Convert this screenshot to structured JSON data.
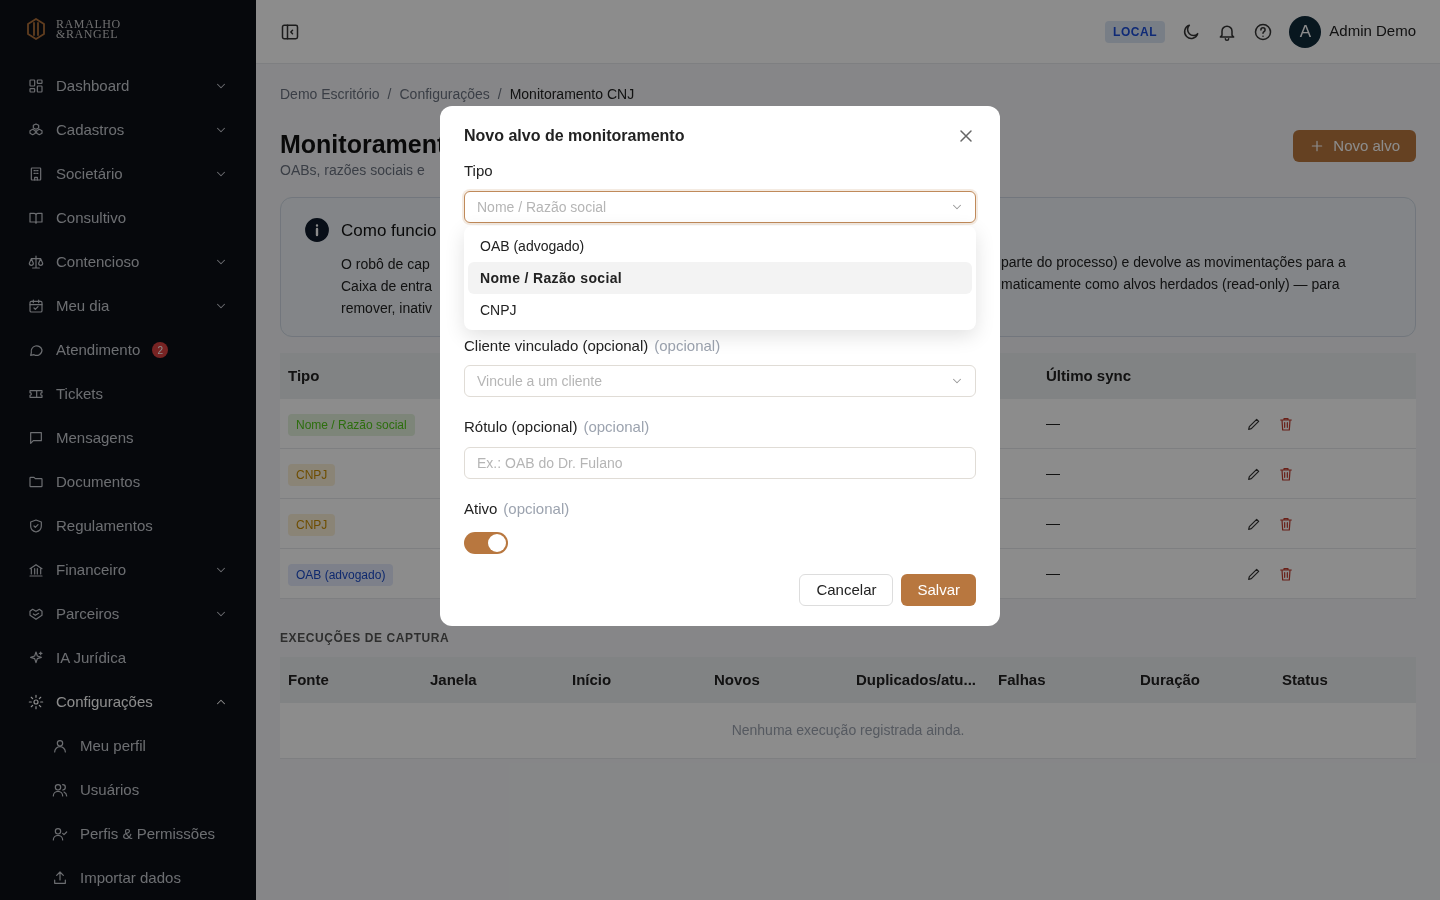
{
  "brand": {
    "line_1": "RAMALHO",
    "line_2": "&RANGEL"
  },
  "sidebar": {
    "items": [
      {
        "label": "Dashboard",
        "has_chevron": true,
        "expanded": false
      },
      {
        "label": "Cadastros",
        "has_chevron": true,
        "expanded": false
      },
      {
        "label": "Societário",
        "has_chevron": true,
        "expanded": false
      },
      {
        "label": "Consultivo",
        "has_chevron": false,
        "expanded": false
      },
      {
        "label": "Contencioso",
        "has_chevron": true,
        "expanded": false
      },
      {
        "label": "Meu dia",
        "has_chevron": true,
        "expanded": false
      },
      {
        "label": "Atendimento",
        "has_chevron": false,
        "expanded": false,
        "badge": "2"
      },
      {
        "label": "Tickets",
        "has_chevron": false,
        "expanded": false
      },
      {
        "label": "Mensagens",
        "has_chevron": false,
        "expanded": false
      },
      {
        "label": "Documentos",
        "has_chevron": false,
        "expanded": false
      },
      {
        "label": "Regulamentos",
        "has_chevron": false,
        "expanded": false
      },
      {
        "label": "Financeiro",
        "has_chevron": true,
        "expanded": false
      },
      {
        "label": "Parceiros",
        "has_chevron": true,
        "expanded": false
      },
      {
        "label": "IA Jurídica",
        "has_chevron": false,
        "expanded": false
      },
      {
        "label": "Configurações",
        "has_chevron": true,
        "expanded": true,
        "children": [
          {
            "label": "Meu perfil"
          },
          {
            "label": "Usuários"
          },
          {
            "label": "Perfis & Permissões"
          },
          {
            "label": "Importar dados"
          }
        ]
      }
    ]
  },
  "header": {
    "env_badge": "LOCAL",
    "avatar_letter": "A",
    "user_name": "Admin Demo"
  },
  "breadcrumb": {
    "separator": "/",
    "items": [
      "Demo Escritório",
      "Configurações",
      "Monitoramento CNJ"
    ]
  },
  "page": {
    "title": "Monitorament",
    "subtitle": "OABs, razões sociais e",
    "new_button": "Novo alvo"
  },
  "info": {
    "title": "Como funcio",
    "left_lines": [
      "O robô de cap",
      "Caixa de entra",
      "remover, inativ"
    ],
    "right_lines": [
      "parte do processo) e devolve as movimentações para a",
      "maticamente como alvos herdados (read-only) — para"
    ]
  },
  "targets_table": {
    "columns": {
      "column_1": "Tipo",
      "column_2": "Último sync"
    },
    "rows": [
      {
        "type": "Nome / Razão social",
        "color": "#7d8579",
        "last_sync": "—"
      },
      {
        "type": "CNPJ",
        "color": "#8a8477",
        "last_sync": "—"
      },
      {
        "type": "CNPJ",
        "color": "#8a8477",
        "last_sync": "—"
      },
      {
        "type": "OAB (advogado)",
        "color": "#7d808a",
        "last_sync": "—"
      }
    ]
  },
  "runs": {
    "title": "EXECUÇÕES DE CAPTURA",
    "columns": [
      "Fonte",
      "Janela",
      "Início",
      "Novos",
      "Duplicados/atu...",
      "Falhas",
      "Duração",
      "Status"
    ],
    "empty_text": "Nenhuma execução registrada ainda."
  },
  "modal": {
    "title": "Novo alvo de monitoramento",
    "type_field": {
      "label": "Tipo",
      "placeholder": "Nome / Razão social",
      "options": [
        {
          "label": "OAB (advogado)",
          "selected": false
        },
        {
          "label": "Nome / Razão social",
          "selected": true
        },
        {
          "label": "CNPJ",
          "selected": false
        }
      ]
    },
    "client_field": {
      "label": "Cliente vinculado (opcional)",
      "hint": "(opcional)",
      "placeholder": "Vincule a um cliente"
    },
    "label_field": {
      "label": "Rótulo (opcional)",
      "hint": "(opcional)",
      "placeholder": "Ex.: OAB do Dr. Fulano"
    },
    "active_field": {
      "label": "Ativo",
      "hint": "(opcional)",
      "on": true
    },
    "buttons": {
      "cancel": "Cancelar",
      "save": "Salvar"
    }
  }
}
